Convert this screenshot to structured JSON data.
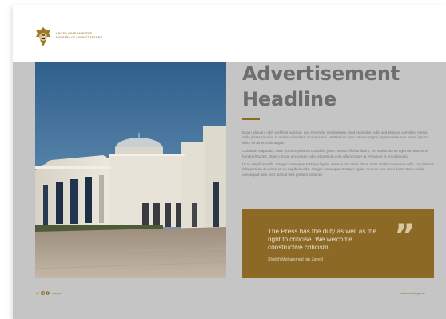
{
  "header": {
    "org_line_1": "UNITED ARAB EMIRATES",
    "org_line_2": "MINISTRY OF CABINET AFFAIRS"
  },
  "main": {
    "headline_line_1": "Advertisement",
    "headline_line_2": "Headline",
    "paragraphs": [
      "Etiam aliquam nibh sed felis pulvinar, nec imperdiet nisl posuere. Sed imperdiet, odio sed tempus convallis, metus nulla pharetra odio, id malesuada diam orci quis nisi. Vestibulum quis rutrum magna, eget malesuada lorem ipsum dolor sit amet nulla augue.",
      "Curabitur vulputate, diam porttitor pretium convallis, justo massa efficitur libero, vel varius dui ex eget mi. Mauris et hendrerit turpis. Etiam rutrum accumsan odio, et pretium ante ullamcorper at. Vivamus et gravida odio.",
      "Ut eu dapibus nulla. Integer consequat tristique ligula. Aenean nec risus dolor. Cras mollis consequat odio, non blandit felis pretium sit amet. Ut eu dapibus nulla. Integer consequat tristique ligula. Aenean nec risus dolor. Cras mollis consequat odio, non blandit felis pretium sit amet."
    ]
  },
  "quote": {
    "text": "The Press has the duty as well as the right to criticise. We welcome constructive criticism.",
    "author": "Sheikh Mohammed bin Zayed",
    "mark": "”"
  },
  "footer": {
    "social_icons": [
      "twitter-icon",
      "instagram-icon",
      "facebook-icon"
    ],
    "handle": "uaegov",
    "website": "www.website.gov.ae"
  },
  "colors": {
    "accent": "#8c6a25",
    "panel": "#c5c5c5",
    "headline": "#6e6e6e"
  }
}
